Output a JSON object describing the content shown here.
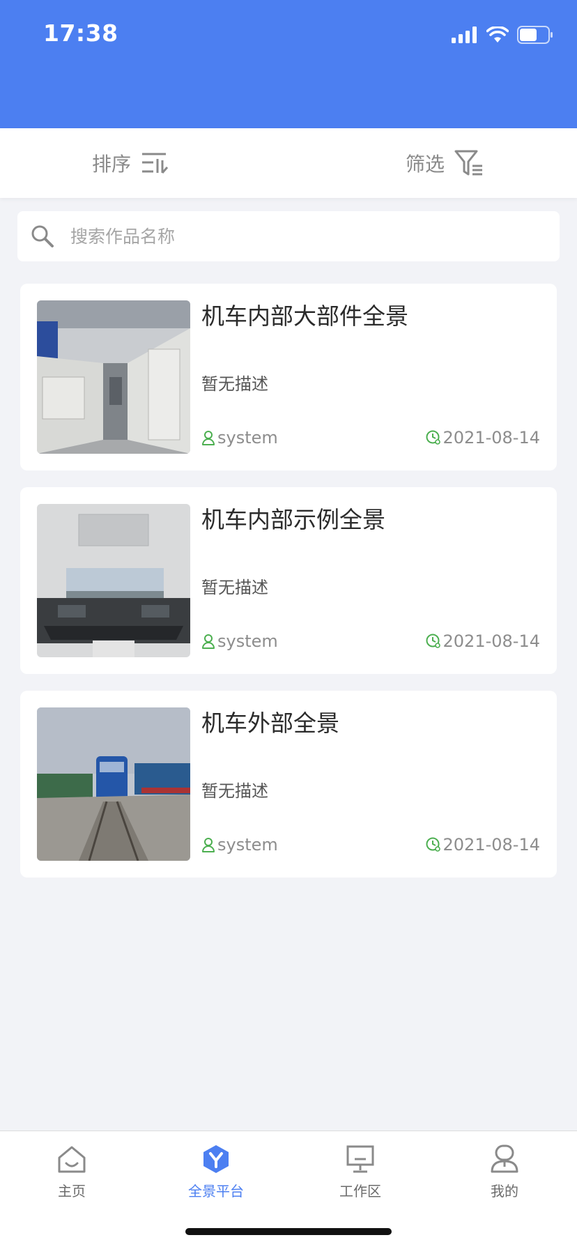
{
  "status_bar": {
    "time": "17:38",
    "icons": [
      "signal-icon",
      "wifi-icon",
      "battery-icon"
    ]
  },
  "toolbar": {
    "sort_label": "排序",
    "filter_label": "筛选"
  },
  "search": {
    "placeholder": "搜索作品名称",
    "value": ""
  },
  "items": [
    {
      "title": "机车内部大部件全景",
      "description": "暂无描述",
      "author": "system",
      "date": "2021-08-14"
    },
    {
      "title": "机车内部示例全景",
      "description": "暂无描述",
      "author": "system",
      "date": "2021-08-14"
    },
    {
      "title": "机车外部全景",
      "description": "暂无描述",
      "author": "system",
      "date": "2021-08-14"
    }
  ],
  "tabbar": {
    "tabs": [
      {
        "label": "主页",
        "icon": "home-icon",
        "active": false
      },
      {
        "label": "全景平台",
        "icon": "panorama-icon",
        "active": true
      },
      {
        "label": "工作区",
        "icon": "monitor-icon",
        "active": false
      },
      {
        "label": "我的",
        "icon": "profile-icon",
        "active": false
      }
    ]
  },
  "colors": {
    "brand": "#4c7ff1",
    "meta_icon": "#4caf50",
    "background": "#f2f3f7"
  }
}
